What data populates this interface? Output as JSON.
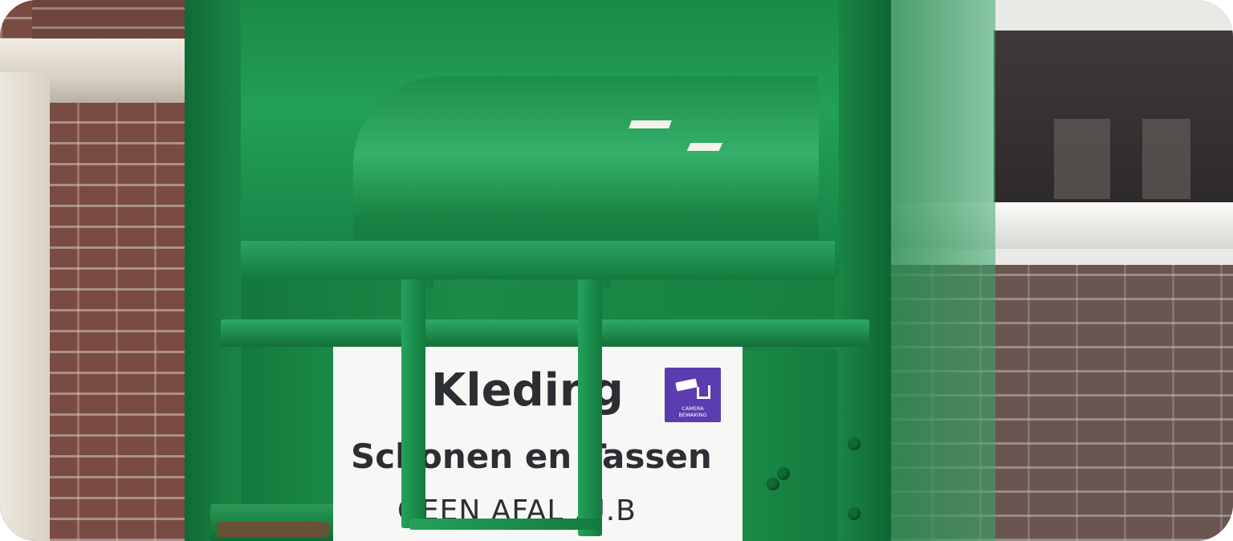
{
  "sign": {
    "title": "Kleding",
    "subtitle": "Schonen en Tassen",
    "line3": "GEEN AFAL .U.B",
    "badge_text_1": "CAMERA",
    "badge_text_2": "BEWAKING"
  },
  "colors": {
    "container_green": "#1b8a48",
    "badge_purple": "#5b3db0",
    "sign_background": "#f7f7f5",
    "sign_text": "#2b2e33",
    "brick": "#7a4b42"
  },
  "icons": {
    "badge_icon": "security-camera-icon"
  }
}
